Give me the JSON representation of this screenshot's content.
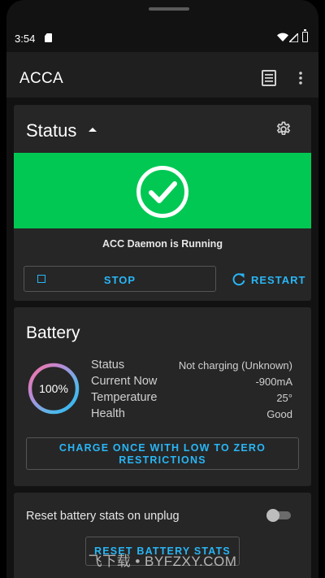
{
  "statusbar": {
    "time": "3:54"
  },
  "appbar": {
    "title": "ACCA"
  },
  "status_card": {
    "title": "Status",
    "daemon_text": "ACC Daemon is Running",
    "stop_label": "STOP",
    "restart_label": "RESTART",
    "banner_color": "#00c853"
  },
  "battery_card": {
    "title": "Battery",
    "percent_label": "100%",
    "level_fraction": 1.0,
    "rows": [
      {
        "label": "Status",
        "value": "Not charging (Unknown)"
      },
      {
        "label": "Current Now",
        "value": "-900mA"
      },
      {
        "label": "Temperature",
        "value": "25°"
      },
      {
        "label": "Health",
        "value": "Good"
      }
    ],
    "charge_button_line1": "CHARGE ONCE WITH LOW TO ZERO",
    "charge_button_line2": "RESTRICTIONS"
  },
  "reset_card": {
    "toggle_label": "Reset battery stats on unplug",
    "toggle_on": false,
    "reset_button_label": "RESET BATTERY STATS"
  },
  "watermark": "飞下载 • BYFZXY.COM",
  "colors": {
    "accent": "#29b6f6",
    "success": "#00c853",
    "card": "#262626",
    "background": "#121212"
  },
  "icons": [
    "sd-card-icon",
    "wifi-icon",
    "signal-icon",
    "battery-icon",
    "log-icon",
    "more-vert-icon",
    "caret-up-icon",
    "gear-icon",
    "check-circle-icon",
    "stop-icon",
    "restart-icon"
  ]
}
